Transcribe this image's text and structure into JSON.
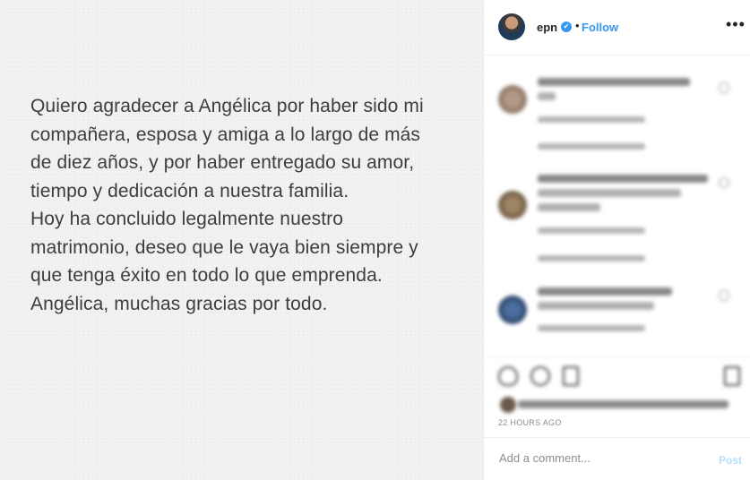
{
  "post": {
    "image_text_lines": [
      "Quiero agradecer a Angélica por haber sido mi",
      "compañera, esposa y amiga a lo largo de más",
      "de diez años, y por haber entregado su amor,",
      "tiempo y dedicación a nuestra familia.",
      "Hoy ha concluido legalmente nuestro",
      "matrimonio, deseo que le vaya bien siempre y",
      "que tenga éxito en todo lo que emprenda.",
      "Angélica, muchas gracias por todo."
    ]
  },
  "header": {
    "username": "epn",
    "verified_icon": "✔",
    "separator": "•",
    "follow_label": "Follow",
    "more_icon": "•••"
  },
  "footer": {
    "timestamp": "22 HOURS AGO",
    "comment_placeholder": "Add a comment...",
    "post_label": "Post"
  },
  "colors": {
    "accent": "#3897f0",
    "post_disabled": "#b2dffc"
  },
  "icons": [
    "heart-icon",
    "comment-icon",
    "share-icon",
    "bookmark-icon"
  ]
}
